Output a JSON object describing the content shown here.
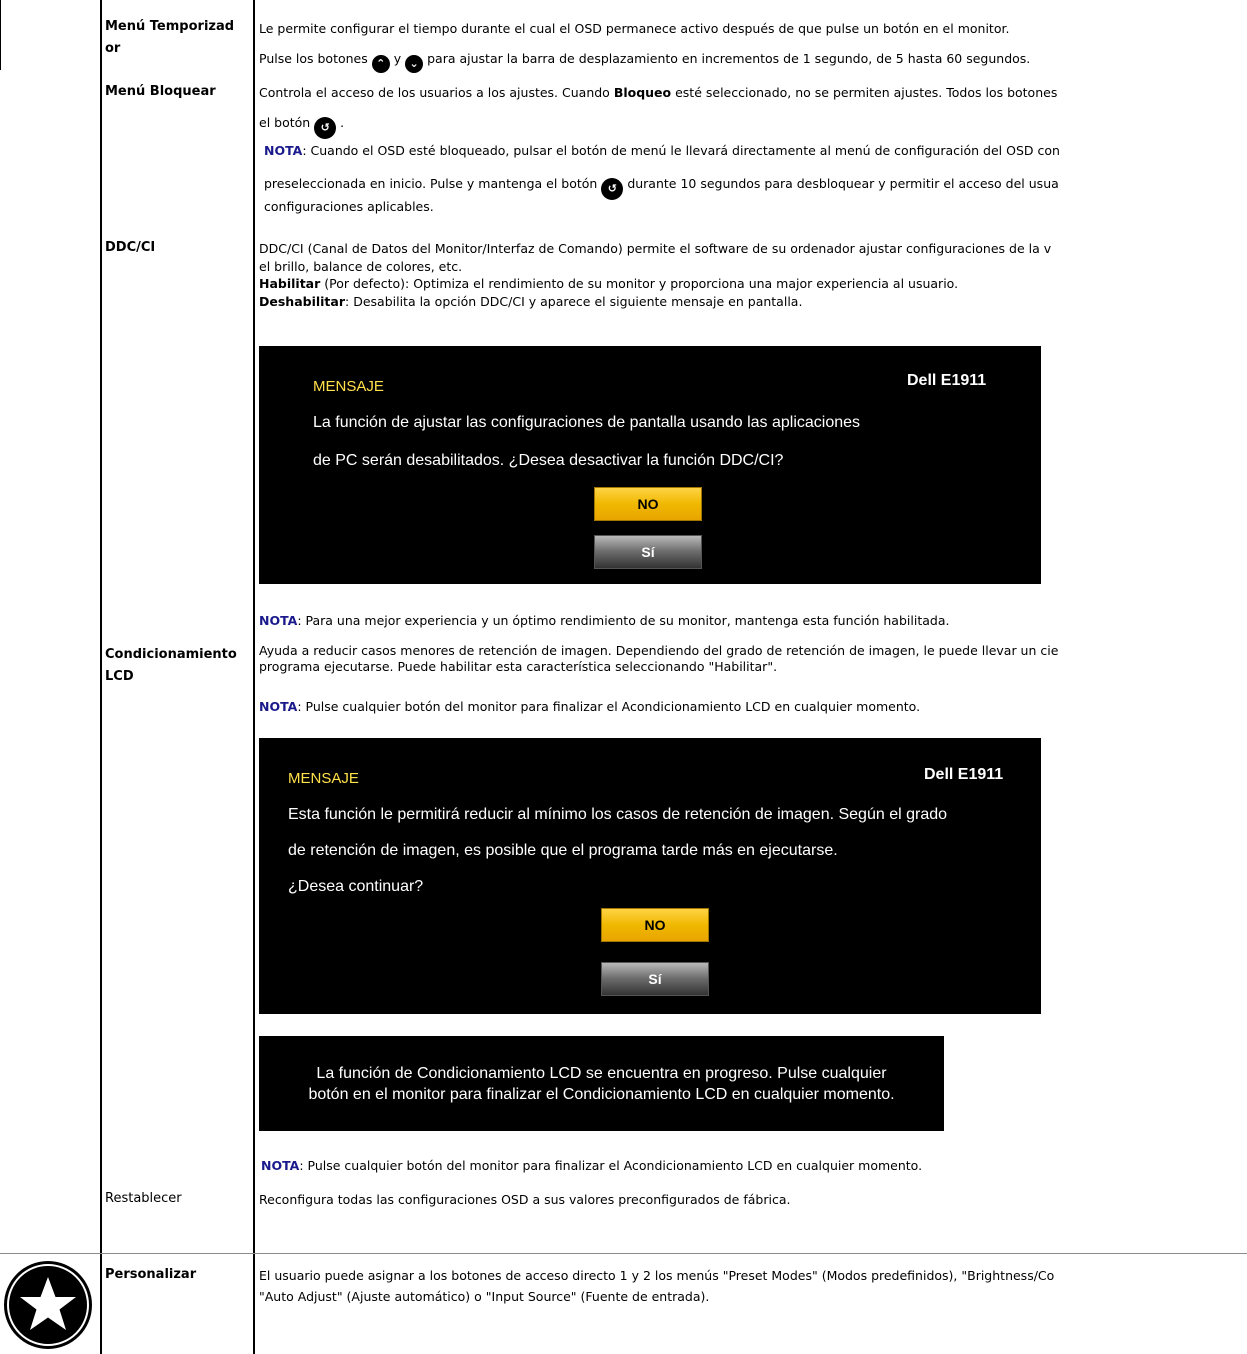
{
  "rows": {
    "menu_temporizador": {
      "label": "Menú Temporizad or",
      "desc1": "Le permite configurar el tiempo durante el cual el OSD permanece activo después de que pulse un botón en el monitor.",
      "desc2a": "Pulse los botones",
      "desc2b": "y",
      "desc2c": "para ajustar la barra de desplazamiento en incrementos de 1 segundo, de 5 hasta 60 segundos."
    },
    "menu_bloquear": {
      "label": "Menú Bloquear",
      "desc1a": "Controla el acceso de los usuarios a los ajustes. Cuando",
      "desc1b": "Bloqueo",
      "desc1c": "esté seleccionado, no se permiten ajustes. Todos los botones",
      "desc2a": "el botón",
      "desc2b": ".",
      "nota_label": "NOTA",
      "nota1": ": Cuando el OSD esté bloqueado, pulsar el botón de menú le llevará directamente al menú de configuración del OSD con",
      "nota2a": "preseleccionada en inicio. Pulse y mantenga el botón",
      "nota2b": "durante 10 segundos para desbloquear y permitir el acceso del usua",
      "nota3": "configuraciones aplicables."
    },
    "ddcci": {
      "label": "DDC/CI",
      "desc1": "DDC/CI (Canal de Datos del Monitor/Interfaz de Comando) permite el software de su ordenador ajustar configuraciones de la v",
      "desc2": "el brillo, balance de colores, etc.",
      "habilitar_label": "Habilitar",
      "habilitar_text": "(Por defecto): Optimiza el rendimiento de su monitor y proporciona una major experiencia al usuario.",
      "deshabilitar_label": "Deshabilitar",
      "deshabilitar_text": ": Desabilita la opción DDC/CI y aparece el siguiente mensaje en pantalla.",
      "osd": {
        "title": "MENSAJE",
        "model": "Dell E1911",
        "line1": "La función de ajustar las configuraciones de pantalla usando las aplicaciones",
        "line2": "de PC serán desabilitados. ¿Desea desactivar la función DDC/CI?",
        "no": "NO",
        "si": "Sí"
      },
      "nota_label": "NOTA",
      "nota_text": ": Para una mejor experiencia y un óptimo rendimiento de su monitor, mantenga esta función habilitada."
    },
    "condicionamiento": {
      "label_line1": "Condicionamiento",
      "label_line2": "LCD",
      "desc1": "Ayuda a reducir casos menores de retención de imagen. Dependiendo del grado de retención de imagen, le puede llevar un cie",
      "desc2": "programa ejecutarse. Puede habilitar esta característica seleccionando \"Habilitar\".",
      "nota_label": "NOTA",
      "nota_text": ": Pulse cualquier botón del monitor para finalizar el Acondicionamiento LCD en cualquier momento.",
      "osd": {
        "title": "MENSAJE",
        "model": "Dell E1911",
        "line1": "Esta función le permitirá reducir al mínimo los casos de retención de imagen. Según el grado",
        "line2": "de retención de imagen, es posible que el programa tarde más en ejecutarse.",
        "line3": "¿Desea continuar?",
        "no": "NO",
        "si": "Sí"
      },
      "progress_line1": "La función de Condicionamiento LCD se encuentra en progreso. Pulse cualquier",
      "progress_line2": "botón en el monitor para finalizar el Condicionamiento LCD en cualquier momento.",
      "nota2_label": "NOTA",
      "nota2_text": ": Pulse cualquier botón del monitor para finalizar el Acondicionamiento LCD en cualquier momento."
    },
    "restablecer": {
      "label": "Restablecer",
      "desc": "Reconfigura todas las configuraciones OSD a sus valores preconfigurados de fábrica."
    },
    "personalizar": {
      "label": "Personalizar",
      "desc1": "El usuario puede asignar a los botones de acceso directo 1 y 2 los menús \"Preset Modes\" (Modos predefinidos), \"Brightness/Co",
      "desc2": "\"Auto Adjust\" (Ajuste automático) o \"Input Source\" (Fuente de entrada)."
    }
  },
  "icons": {
    "up_button": "chevron-up-icon",
    "down_button": "chevron-down-icon",
    "back_button": "back-arrow-icon",
    "personalize_badge": "star-icon"
  }
}
